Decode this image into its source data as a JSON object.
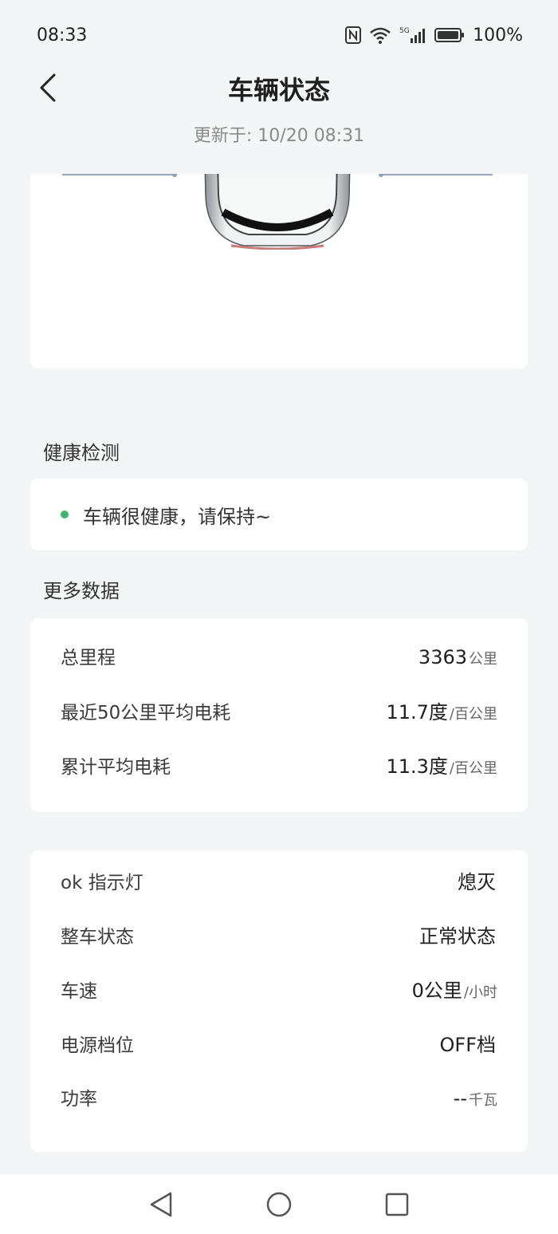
{
  "status_bar": {
    "time": "08:33",
    "battery_percent": "100%",
    "network": "5G",
    "icons": {
      "nfc": "nfc-icon",
      "wifi": "wifi-icon",
      "signal": "signal-icon",
      "battery": "battery-icon"
    }
  },
  "header": {
    "title": "车辆状态",
    "updated": "更新于: 10/20 08:31",
    "back_icon": "chevron-left-icon"
  },
  "health": {
    "section_title": "健康检测",
    "message": "车辆很健康，请保持~",
    "status_color": "#42b46a"
  },
  "more_data": {
    "section_title": "更多数据",
    "rows": [
      {
        "label": "总里程",
        "value": "3363",
        "unit": "公里"
      },
      {
        "label": "最近50公里平均电耗",
        "value": "11.7度",
        "unit": "/百公里"
      },
      {
        "label": "累计平均电耗",
        "value": "11.3度",
        "unit": "/百公里"
      }
    ]
  },
  "vehicle_status": {
    "rows": [
      {
        "label": "ok 指示灯",
        "value": "熄灭",
        "unit": ""
      },
      {
        "label": "整车状态",
        "value": "正常状态",
        "unit": ""
      },
      {
        "label": "车速",
        "value": "0公里",
        "unit": "/小时"
      },
      {
        "label": "电源档位",
        "value": "OFF档",
        "unit": ""
      },
      {
        "label": "功率",
        "value": "--",
        "unit": "千瓦"
      }
    ]
  },
  "nav": {
    "back_icon": "triangle-back-icon",
    "home_icon": "circle-home-icon",
    "recent_icon": "square-recent-icon"
  }
}
